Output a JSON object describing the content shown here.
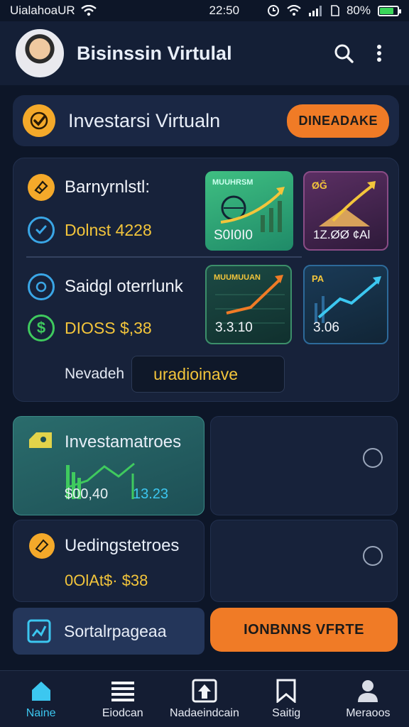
{
  "status_bar": {
    "carrier": "UialahoaUR",
    "time": "22:50",
    "battery": "80%"
  },
  "header": {
    "title": "Bisinssin Virtulal"
  },
  "banner": {
    "title": "Investarsi Virtualn",
    "cta_label": "DINEADAKE",
    "accent": "#f07b26"
  },
  "main_card": {
    "row1": {
      "label": "Barnyrnlstl:",
      "value": "Dolnst 4228"
    },
    "row2": {
      "label": "Saidgl oterrlunk",
      "value": "DIOSS $,38"
    },
    "thumbs": [
      {
        "label": "MUUHRSM",
        "value": "S0I0I0"
      },
      {
        "label": "ØĞ",
        "value": "1Z.ØØ ¢Al"
      },
      {
        "label": "MUUMUUAN",
        "value": "3.3.10"
      },
      {
        "label": "PA",
        "value": "3.06"
      }
    ],
    "select": {
      "label": "Nevadeh",
      "value": "uradioinave"
    }
  },
  "tiles": {
    "invest": {
      "title": "Investamatroes",
      "value_left": "$00,40",
      "value_right": "13.23"
    },
    "trading": {
      "title": "Uedingstetroes",
      "value": "0OlAt$· $38"
    }
  },
  "buttons": {
    "left_label": "Sortalrpageaa",
    "right_label": "IONBNNS VFRTE"
  },
  "nav": [
    {
      "label": "Naine",
      "icon": "home-icon"
    },
    {
      "label": "Eiodcan",
      "icon": "list-icon"
    },
    {
      "label": "Nadaeindcain",
      "icon": "upload-icon"
    },
    {
      "label": "Saitig",
      "icon": "bookmark-icon"
    },
    {
      "label": "Meraoos",
      "icon": "person-icon"
    }
  ]
}
